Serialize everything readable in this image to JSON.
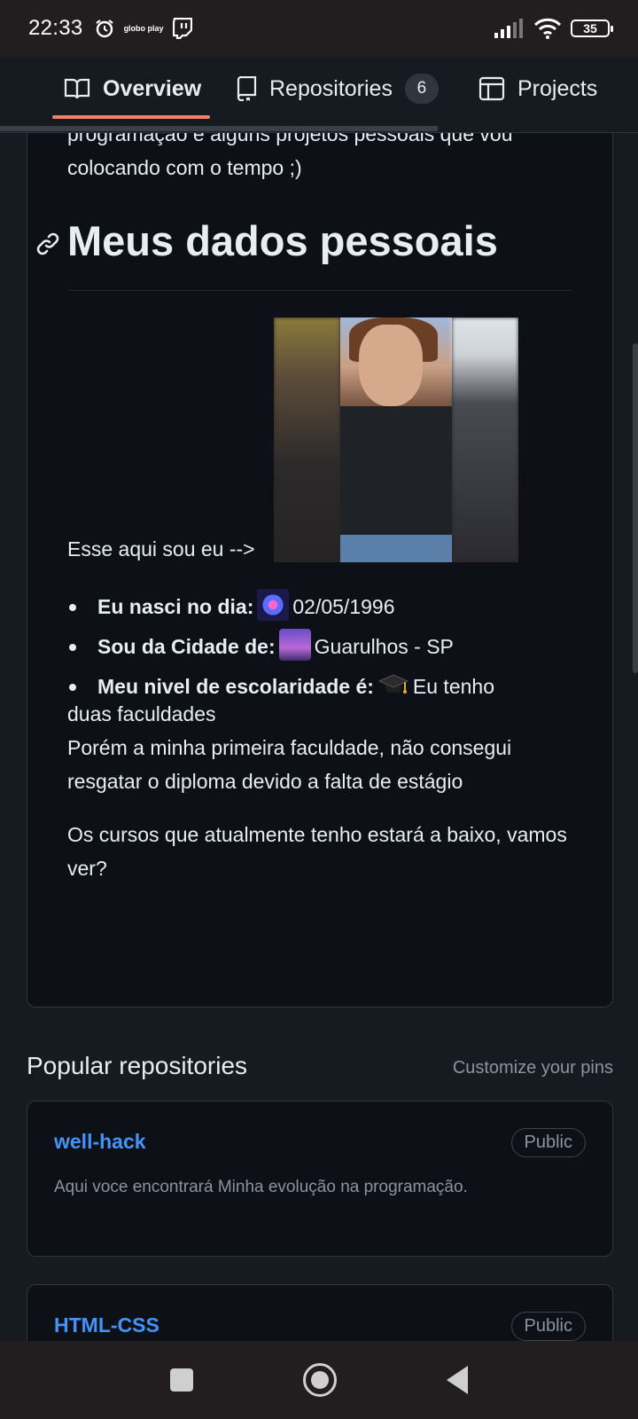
{
  "status_bar": {
    "time": "22:33",
    "app_icons": [
      "alarm-icon",
      "globoplay-icon",
      "twitch-icon"
    ],
    "globoplay_text": "globo play",
    "battery": "35"
  },
  "tabs": [
    {
      "label": "Overview",
      "icon": "book-icon",
      "active": true
    },
    {
      "label": "Repositories",
      "icon": "repo-icon",
      "count": "6"
    },
    {
      "label": "Projects",
      "icon": "table-icon"
    }
  ],
  "readme": {
    "cut_line": "programação e alguns projetos pessoais que vou",
    "cont_line": "colocando com o tempo ;)",
    "heading": "Meus dados pessoais",
    "photo_caption": "Esse aqui sou eu -->",
    "facts": [
      {
        "label": "Eu nasci no dia:",
        "emoji": "fireworks",
        "value": "02/05/1996"
      },
      {
        "label": "Sou da Cidade de:",
        "emoji": "city-dusk",
        "value": "Guarulhos - SP"
      },
      {
        "label": "Meu nivel de escolaridade é:",
        "emoji": "graduation-cap",
        "value": "Eu tenho"
      }
    ],
    "education_wrap": "duas faculdades",
    "education_note": "Porém a minha primeira faculdade, não consegui resgatar o diploma devido a falta de estágio",
    "courses_line": "Os cursos que atualmente tenho estará a baixo, vamos ver?"
  },
  "popular": {
    "title": "Popular repositories",
    "customize": "Customize your pins",
    "repos": [
      {
        "name": "well-hack",
        "visibility": "Public",
        "description": "Aqui voce encontrará Minha evolução na programação."
      },
      {
        "name": "HTML-CSS",
        "visibility": "Public",
        "description": ""
      }
    ]
  },
  "colors": {
    "accent_underline": "#f78166",
    "link": "#4493f8",
    "background": "#0d1117"
  }
}
